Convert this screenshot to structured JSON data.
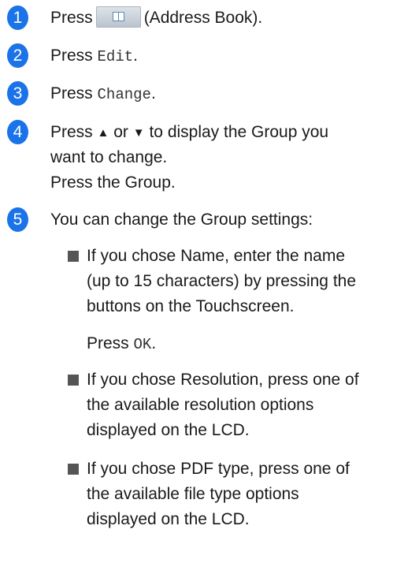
{
  "steps": [
    {
      "num": "1",
      "press": "Press",
      "after": "(Address Book)."
    },
    {
      "num": "2",
      "press": "Press",
      "code": "Edit",
      "after": "."
    },
    {
      "num": "3",
      "press": "Press",
      "code": "Change",
      "after": "."
    },
    {
      "num": "4",
      "line1_a": "Press",
      "up": "▲",
      "or": "or",
      "down": "▼",
      "line1_b": "to display the Group you",
      "line2": "want to change.",
      "line3": "Press the Group."
    },
    {
      "num": "5",
      "text": "You can change the Group settings:"
    }
  ],
  "address_book_icon": "address-book-icon",
  "bullets": [
    {
      "lines": [
        "If you chose Name, enter the name",
        "(up to 15 characters) by pressing the",
        "buttons on the Touchscreen."
      ],
      "press": "Press",
      "code": "OK",
      "after": "."
    },
    {
      "lines": [
        "If you chose Resolution, press one of",
        "the available resolution options",
        "displayed on the LCD."
      ]
    },
    {
      "lines": [
        "If you chose PDF type, press one of",
        "the available file type options",
        "displayed on the LCD."
      ]
    }
  ],
  "colors": {
    "step_badge": "#1a73e8",
    "bullet": "#555555"
  }
}
